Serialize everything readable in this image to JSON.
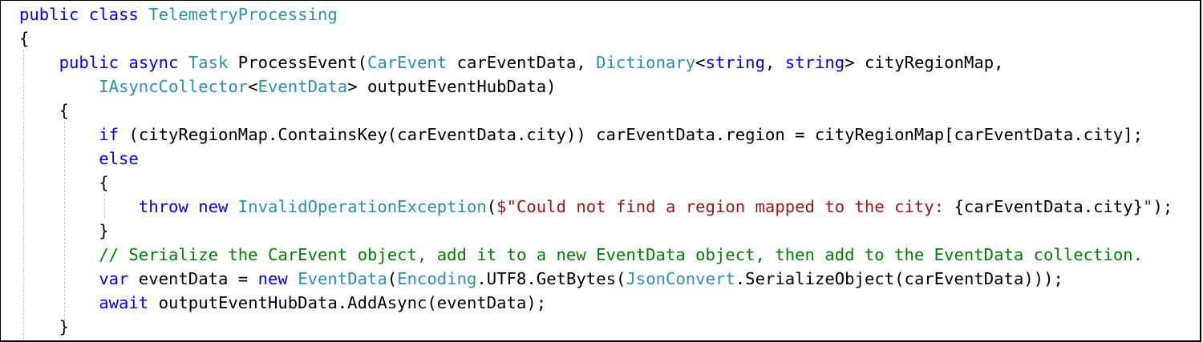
{
  "editor": {
    "lines": [
      [
        {
          "t": "public class ",
          "c": "kw"
        },
        {
          "t": "TelemetryProcessing",
          "c": "ty"
        }
      ],
      [
        {
          "t": "{",
          "c": "pl"
        }
      ],
      [
        {
          "t": "    public async ",
          "c": "kw"
        },
        {
          "t": "Task",
          "c": "ty"
        },
        {
          "t": " ProcessEvent(",
          "c": "pl"
        },
        {
          "t": "CarEvent",
          "c": "ty"
        },
        {
          "t": " carEventData, ",
          "c": "pl"
        },
        {
          "t": "Dictionary",
          "c": "ty"
        },
        {
          "t": "<",
          "c": "pl"
        },
        {
          "t": "string",
          "c": "kw"
        },
        {
          "t": ", ",
          "c": "pl"
        },
        {
          "t": "string",
          "c": "kw"
        },
        {
          "t": "> cityRegionMap,",
          "c": "pl"
        }
      ],
      [
        {
          "t": "        ",
          "c": "pl"
        },
        {
          "t": "IAsyncCollector",
          "c": "ty"
        },
        {
          "t": "<",
          "c": "pl"
        },
        {
          "t": "EventData",
          "c": "ty"
        },
        {
          "t": "> outputEventHubData)",
          "c": "pl"
        }
      ],
      [
        {
          "t": "    {",
          "c": "pl"
        }
      ],
      [
        {
          "t": "        ",
          "c": "pl"
        },
        {
          "t": "if",
          "c": "kw"
        },
        {
          "t": " (cityRegionMap.ContainsKey(carEventData.city)) carEventData.region = cityRegionMap[carEventData.city];",
          "c": "pl"
        }
      ],
      [
        {
          "t": "        ",
          "c": "pl"
        },
        {
          "t": "else",
          "c": "kw"
        }
      ],
      [
        {
          "t": "        {",
          "c": "pl"
        }
      ],
      [
        {
          "t": "            ",
          "c": "pl"
        },
        {
          "t": "throw new ",
          "c": "kw"
        },
        {
          "t": "InvalidOperationException",
          "c": "ty"
        },
        {
          "t": "(",
          "c": "pl"
        },
        {
          "t": "$\"Could not find a region mapped to the city: ",
          "c": "st"
        },
        {
          "t": "{carEventData.city}",
          "c": "pl"
        },
        {
          "t": "\"",
          "c": "st"
        },
        {
          "t": ");",
          "c": "pl"
        }
      ],
      [
        {
          "t": "        }",
          "c": "pl"
        }
      ],
      [
        {
          "t": "        ",
          "c": "pl"
        },
        {
          "t": "// Serialize the CarEvent object, add it to a new EventData object, then add to the EventData collection.",
          "c": "cm"
        }
      ],
      [
        {
          "t": "        ",
          "c": "pl"
        },
        {
          "t": "var",
          "c": "kw"
        },
        {
          "t": " eventData = ",
          "c": "pl"
        },
        {
          "t": "new ",
          "c": "kw"
        },
        {
          "t": "EventData",
          "c": "ty"
        },
        {
          "t": "(",
          "c": "pl"
        },
        {
          "t": "Encoding",
          "c": "ty"
        },
        {
          "t": ".UTF8.GetBytes(",
          "c": "pl"
        },
        {
          "t": "JsonConvert",
          "c": "ty"
        },
        {
          "t": ".SerializeObject(carEventData)));",
          "c": "pl"
        }
      ],
      [
        {
          "t": "        ",
          "c": "pl"
        },
        {
          "t": "await",
          "c": "kw"
        },
        {
          "t": " outputEventHubData.AddAsync(eventData);",
          "c": "pl"
        }
      ],
      [
        {
          "t": "    }",
          "c": "pl"
        }
      ]
    ]
  }
}
